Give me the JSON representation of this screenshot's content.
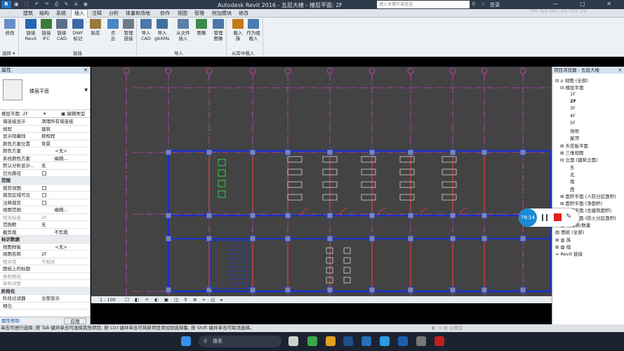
{
  "title_bar": {
    "app_icon": "R",
    "quick_access": "▣ ⬚ ↶ ↷ ⎙ ✎ A ◉",
    "title": "Autodesk Revit 2016 -   五层大楼 - 楼层平面: 2F",
    "search_placeholder": "键入关键字或短语",
    "user": "登录",
    "window_buttons": "— ▢ ✕",
    "tb_icons": "⚲ ☆"
  },
  "fps_readout": "FPS: N/A  GPU: 0%  CPU: 2%",
  "tabs": [
    "建筑",
    "结构",
    "系统",
    "插入",
    "注释",
    "分析",
    "体量和场地",
    "协作",
    "视图",
    "管理",
    "附加模块",
    "修改"
  ],
  "active_tab": "插入",
  "ribbon": {
    "buttons": [
      {
        "label": "修改",
        "icon": "cursor-icon",
        "color": "#6a8fc7"
      },
      {
        "label": "链接\nRevit",
        "icon": "link-revit-icon",
        "color": "#2467b3"
      },
      {
        "label": "链接\nIFC",
        "icon": "link-ifc-icon",
        "color": "#3b7a3b"
      },
      {
        "label": "链接\nCAD",
        "icon": "link-cad-icon",
        "color": "#5c6f88"
      },
      {
        "label": "DWF\n标记",
        "icon": "dwf-icon",
        "color": "#3a6aa8"
      },
      {
        "label": "贴花",
        "icon": "decal-icon",
        "color": "#9a7a40"
      },
      {
        "label": "点\n云",
        "icon": "point-cloud-icon",
        "color": "#4a85c5"
      },
      {
        "label": "管理\n链接",
        "icon": "manage-links-icon",
        "color": "#6e7d8c"
      },
      {
        "label": "导入\nCAD",
        "icon": "import-cad-icon",
        "color": "#4f77a8"
      },
      {
        "label": "导入\ngbXML",
        "icon": "import-gbxml-icon",
        "color": "#3f6f99"
      },
      {
        "label": "从文件\n插入",
        "icon": "insert-from-file-icon",
        "color": "#5b7fa9"
      },
      {
        "label": "图像",
        "icon": "image-icon",
        "color": "#3b8b4c"
      },
      {
        "label": "管理\n图像",
        "icon": "manage-images-icon",
        "color": "#4a77a8"
      },
      {
        "label": "载入\n族",
        "icon": "load-family-icon",
        "color": "#c47a1c"
      },
      {
        "label": "作为组\n载入",
        "icon": "load-as-group-icon",
        "color": "#4a7bb0"
      }
    ],
    "panels": {
      "select": "选择 ▾",
      "link": "链接",
      "import": "导入",
      "library": "从库中载入"
    }
  },
  "properties": {
    "title": "属性",
    "close": "✕",
    "type_name": "楼层平面",
    "floor_selector": "楼层平面: 2F",
    "edit_type": "编辑类型",
    "rows": [
      {
        "k": "墙连接显示",
        "v": "清理所有墙连接",
        "kind": "text"
      },
      {
        "k": "规程",
        "v": "建筑",
        "kind": "text"
      },
      {
        "k": "显示隐藏线",
        "v": "按规程",
        "kind": "text"
      },
      {
        "k": "颜色方案位置",
        "v": "背景",
        "kind": "text"
      },
      {
        "k": "颜色方案",
        "v": "<无>",
        "kind": "button"
      },
      {
        "k": "系统颜色方案",
        "v": "编辑...",
        "kind": "button"
      },
      {
        "k": "默认分析显示...",
        "v": "无",
        "kind": "text"
      },
      {
        "k": "日光路径",
        "v": "",
        "kind": "check"
      },
      {
        "k": "范围",
        "v": "",
        "kind": "group"
      },
      {
        "k": "裁剪视图",
        "v": "",
        "kind": "check"
      },
      {
        "k": "裁剪区域可见",
        "v": "",
        "kind": "check"
      },
      {
        "k": "注释裁剪",
        "v": "",
        "kind": "check"
      },
      {
        "k": "视图范围",
        "v": "编辑...",
        "kind": "button"
      },
      {
        "k": "相关标高",
        "v": "2F",
        "kind": "dim"
      },
      {
        "k": "范围框",
        "v": "无",
        "kind": "text"
      },
      {
        "k": "截剪裁",
        "v": "不剪裁",
        "kind": "button"
      },
      {
        "k": "标识数据",
        "v": "",
        "kind": "group"
      },
      {
        "k": "视图样板",
        "v": "<无>",
        "kind": "button"
      },
      {
        "k": "视图名称",
        "v": "2F",
        "kind": "text"
      },
      {
        "k": "相关性",
        "v": "不相关",
        "kind": "dim"
      },
      {
        "k": "图纸上的标题",
        "v": "",
        "kind": "text"
      },
      {
        "k": "参照图纸",
        "v": "",
        "kind": "dim"
      },
      {
        "k": "参照详图",
        "v": "",
        "kind": "dim"
      },
      {
        "k": "阶段化",
        "v": "",
        "kind": "group"
      },
      {
        "k": "阶段过滤器",
        "v": "全部显示",
        "kind": "text"
      },
      {
        "k": "相位",
        "v": "",
        "kind": "text"
      }
    ],
    "help": "属性帮助",
    "apply": "应用"
  },
  "project_browser": {
    "title": "项目浏览器 - 五层大楼",
    "close": "✕",
    "nodes": [
      {
        "text": "⊟ ⌂ 视图 (全部)",
        "indent": 0
      },
      {
        "text": "⊟ 楼层平面",
        "indent": 1
      },
      {
        "text": "1F",
        "indent": 3
      },
      {
        "text": "2F",
        "indent": 3,
        "selected": true
      },
      {
        "text": "3F",
        "indent": 3
      },
      {
        "text": "4F",
        "indent": 3
      },
      {
        "text": "5F",
        "indent": 3
      },
      {
        "text": "场地",
        "indent": 3
      },
      {
        "text": "屋顶",
        "indent": 3
      },
      {
        "text": "⊞ 天花板平面",
        "indent": 1
      },
      {
        "text": "⊞ 三维视图",
        "indent": 1
      },
      {
        "text": "⊟ 立面 (建筑立面)",
        "indent": 1
      },
      {
        "text": "东",
        "indent": 3
      },
      {
        "text": "北",
        "indent": 3
      },
      {
        "text": "南",
        "indent": 3
      },
      {
        "text": "西",
        "indent": 3
      },
      {
        "text": "⊞ 面积平面 (人防分区面积)",
        "indent": 1
      },
      {
        "text": "⊞ 面积平面 (净面积)",
        "indent": 1
      },
      {
        "text": "⊞ 面积平面 (总建筑面积)",
        "indent": 1
      },
      {
        "text": "⊞ 面积平面 (防火分区面积)",
        "indent": 1
      },
      {
        "text": "⊞ ▦ 明细表/数量",
        "indent": 0
      },
      {
        "text": "▤ 图纸 (全部)",
        "indent": 0
      },
      {
        "text": "⊞ ▥ 族",
        "indent": 0
      },
      {
        "text": "⊞ ▧ 组",
        "indent": 0
      },
      {
        "text": "∞ Revit 链接",
        "indent": 0
      }
    ]
  },
  "view_bar": {
    "scale": "1 : 100",
    "icons": "☐ ◧ ☼ ◐ ▣ ◫ ⚲ ⊕ ⌖ ◱ ▸"
  },
  "status_bar": {
    "message": "单击可进行选择; 按 Tab 键并单击可选择其他项目; 按 Ctrl 键并单击可将新项目添加到选择集; 按 Shift 键并单击可取消选择。",
    "tail": "◧  :0   ▤  主模型"
  },
  "recorder": {
    "time": "78:14"
  },
  "taskbar": {
    "search": "搜索"
  },
  "colors": {
    "canvas": "#434343",
    "grid": "#d046c7",
    "wall": "#1830d0",
    "partition": "#e04040",
    "fixture": "#e8e8e8",
    "accent": "#1a8ad6"
  }
}
